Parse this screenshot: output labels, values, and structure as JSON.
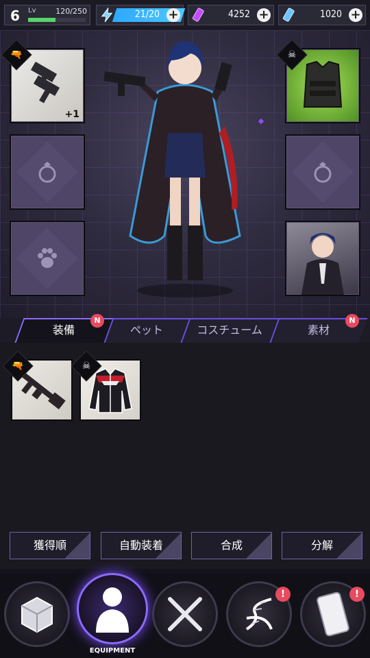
{
  "player": {
    "level": "6",
    "level_label": "Lv",
    "exp_text": "120/250",
    "exp_fraction": 0.48
  },
  "resources": {
    "energy": {
      "value": "21/20",
      "icon": "lightning-icon",
      "color": "#2da9ff"
    },
    "gems": {
      "value": "4252",
      "icon": "gem-icon",
      "color": "#d44dff"
    },
    "tickets": {
      "value": "1020",
      "icon": "ticket-icon",
      "color": "#7fd0ff"
    }
  },
  "equipment_slots": {
    "weapon": {
      "icon": "pistol-icon",
      "enhance": "+1"
    },
    "armor": {
      "icon": "gasmask-icon"
    },
    "ring_left": {
      "icon": "ring-icon"
    },
    "ring_right": {
      "icon": "ring-icon"
    },
    "pet": {
      "icon": "paw-icon"
    },
    "costume": {
      "icon": "costume-icon"
    }
  },
  "tabs": [
    {
      "label": "装備",
      "badge": "N"
    },
    {
      "label": "ペット"
    },
    {
      "label": "コスチューム"
    },
    {
      "label": "素材",
      "badge": "N"
    }
  ],
  "inventory": [
    {
      "type": "rifle",
      "icon": "pistol-icon"
    },
    {
      "type": "jacket",
      "icon": "gasmask-icon"
    }
  ],
  "actions": {
    "sort": "獲得順",
    "auto_equip": "自動装着",
    "synthesize": "合成",
    "disassemble": "分解"
  },
  "nav": {
    "active_label": "EQUIPMENT",
    "alert_symbol": "!"
  }
}
